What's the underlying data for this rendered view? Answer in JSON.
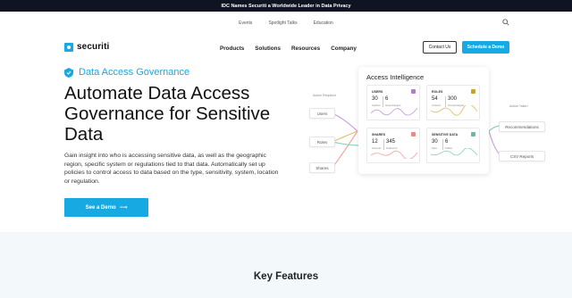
{
  "announcement": {
    "text": "IDC Names Securiti a Worldwide Leader in Data Privacy"
  },
  "utility_nav": {
    "items": [
      "Events",
      "Spotlight Talks",
      "Education"
    ],
    "search_icon": "search-icon"
  },
  "brand": {
    "name": "securiti",
    "accent": "#17a9e1"
  },
  "main_nav": {
    "items": [
      "Products",
      "Solutions",
      "Resources",
      "Company"
    ],
    "contact_label": "Contact Us",
    "demo_label": "Schedule a Demo"
  },
  "hero": {
    "eyebrow": "Data Access Governance",
    "headline": "Automate Data Access Governance for Sensitive Data",
    "description": "Gain insight into who is accessing sensitive data, as well as the geographic region, specific system or regulations tied to that data. Automatically set up policies to control access to data based on the type, sensitivity, system, location or regulation.",
    "cta_label": "See a Demo",
    "cta_arrow": "⟶"
  },
  "visual": {
    "card_title": "Access Intelligence",
    "left_title": "Action Required",
    "left_pills": [
      "Users",
      "Roles",
      "Shares"
    ],
    "right_title": "Action Taken",
    "right_pills": [
      "Recommendations",
      "CSV Reports"
    ],
    "tiles": [
      {
        "label": "USERS",
        "badge_color": "#b07cc6",
        "n1": "30",
        "s1": "Inactive",
        "n2": "6",
        "s2": "Geoprivileged",
        "line_color": "#c9a3dd"
      },
      {
        "label": "ROLES",
        "badge_color": "#c9a227",
        "n1": "54",
        "s1": "Unused",
        "n2": "300",
        "s2": "Overprivileged",
        "line_color": "#e4c06a"
      },
      {
        "label": "SHARES",
        "badge_color": "#e98a83",
        "n1": "12",
        "s1": "Inbound",
        "n2": "345",
        "s2": "Outbound",
        "line_color": "#f1a9a2"
      },
      {
        "label": "SENSITIVE DATA",
        "badge_color": "#6fb7a5",
        "n1": "30",
        "s1": "Files",
        "n2": "6",
        "s2": "Tables",
        "line_color": "#8fd1c0"
      }
    ]
  },
  "features": {
    "title": "Key Features"
  }
}
